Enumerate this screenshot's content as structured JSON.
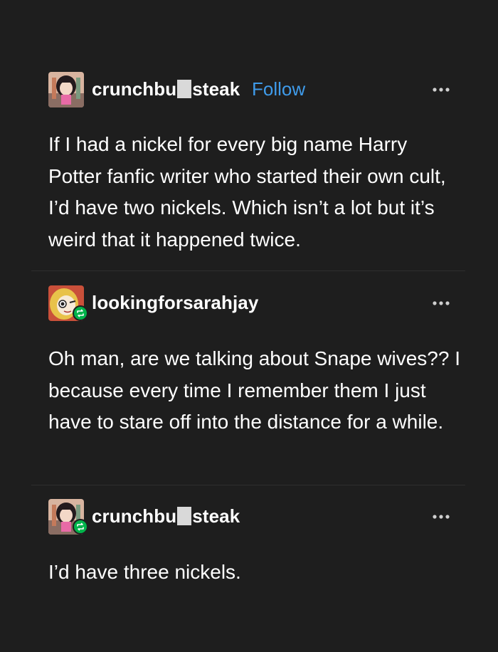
{
  "posts": [
    {
      "username_part1": "crunchbu",
      "username_part2": "steak",
      "follow_label": "Follow",
      "body": "If I had a nickel for every big name Harry Potter fanfic writer who started their own cult, I’d have two nickels.  Which isn’t a lot but it’s weird that it happened twice.",
      "avatar_icon": "anime-girl-avatar",
      "more_icon": "ellipsis-icon"
    },
    {
      "username": "lookingforsarahjay",
      "body": "Oh man, are we talking about Snape wives?? I because every time I remember them I just have to stare off into the distance for a while.",
      "avatar_icon": "cartoon-blonde-avatar",
      "badge_icon": "reblog-icon",
      "more_icon": "ellipsis-icon"
    },
    {
      "username_part1": "crunchbu",
      "username_part2": "steak",
      "body": "I’d have three nickels.",
      "avatar_icon": "anime-girl-avatar",
      "badge_icon": "reblog-icon",
      "more_icon": "ellipsis-icon"
    }
  ],
  "colors": {
    "background": "#1e1e1e",
    "text": "#ffffff",
    "follow": "#3f9bea",
    "reblog_badge": "#00b44b"
  }
}
